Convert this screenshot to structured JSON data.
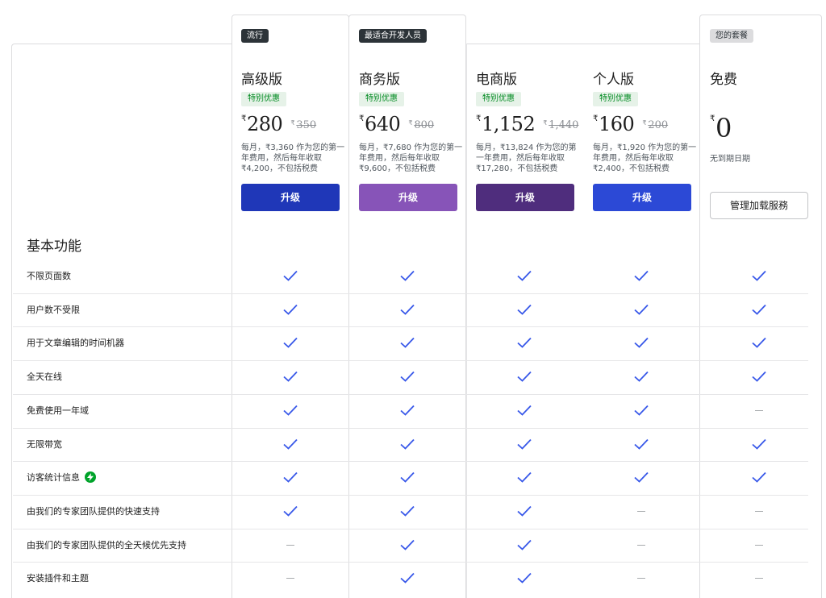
{
  "section_title": "基本功能",
  "plans": [
    {
      "tag": "流行",
      "tag_style": "dark",
      "name": "高级版",
      "promo": "特别优惠",
      "currency": "₹",
      "price": "280",
      "old_currency": "₹",
      "old_price": "350",
      "desc": "每月，₹3,360 作为您的第一年费用，然后每年收取 ₹4,200，不包括税费",
      "button": "升级",
      "button_color": "#1f37b8"
    },
    {
      "tag": "最适合开发人员",
      "tag_style": "dark",
      "name": "商务版",
      "promo": "特别优惠",
      "currency": "₹",
      "price": "640",
      "old_currency": "₹",
      "old_price": "800",
      "desc": "每月，₹7,680 作为您的第一年费用，然后每年收取 ₹9,600，不包括税费",
      "button": "升级",
      "button_color": "#8754b8"
    },
    {
      "tag": "",
      "tag_style": "none",
      "name": "电商版",
      "promo": "特别优惠",
      "currency": "₹",
      "price": "1,152",
      "old_currency": "₹",
      "old_price": "1,440",
      "desc": "每月，₹13,824 作为您的第一年费用，然后每年收取 ₹17,280，不包括税费",
      "button": "升级",
      "button_color": "#4f2d7d"
    },
    {
      "tag": "",
      "tag_style": "none",
      "name": "个人版",
      "promo": "特别优惠",
      "currency": "₹",
      "price": "160",
      "old_currency": "₹",
      "old_price": "200",
      "desc": "每月，₹1,920 作为您的第一年费用，然后每年收取 ₹2,400，不包括税费",
      "button": "升级",
      "button_color": "#2c49d6"
    },
    {
      "tag": "您的套餐",
      "tag_style": "light",
      "name": "免费",
      "currency": "₹",
      "price": "0",
      "note": "无到期日期",
      "button": "管理加载服務"
    }
  ],
  "features": [
    {
      "label": "不限页面数",
      "values": [
        true,
        true,
        true,
        true,
        true
      ]
    },
    {
      "label": "用户数不受限",
      "values": [
        true,
        true,
        true,
        true,
        true
      ]
    },
    {
      "label": "用于文章编辑的时间机器",
      "values": [
        true,
        true,
        true,
        true,
        true
      ]
    },
    {
      "label": "全天在线",
      "values": [
        true,
        true,
        true,
        true,
        true
      ]
    },
    {
      "label": "免费使用一年域",
      "values": [
        true,
        true,
        true,
        true,
        false
      ]
    },
    {
      "label": "无限带宽",
      "values": [
        true,
        true,
        true,
        true,
        true
      ]
    },
    {
      "label": "访客统计信息",
      "icon": "lightning-badge-icon",
      "values": [
        true,
        true,
        true,
        true,
        true
      ]
    },
    {
      "label": "由我们的专家团队提供的快速支持",
      "values": [
        true,
        true,
        true,
        false,
        false
      ]
    },
    {
      "label": "由我们的专家团队提供的全天候优先支持",
      "values": [
        false,
        true,
        true,
        false,
        false
      ]
    },
    {
      "label": "安装插件和主题",
      "values": [
        false,
        true,
        true,
        false,
        false
      ]
    }
  ],
  "colors": {
    "check": "#3858e9",
    "dash": "#a7aaad",
    "promo_bg": "#e6f2e8",
    "promo_text": "#008a20"
  }
}
